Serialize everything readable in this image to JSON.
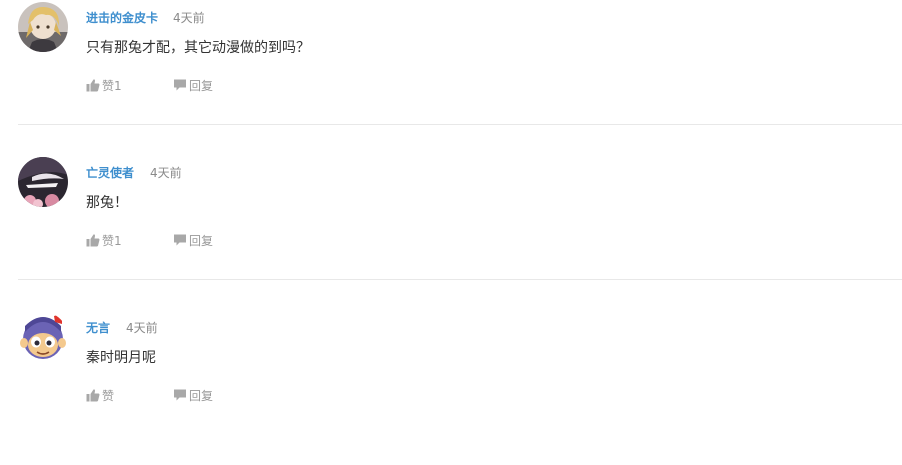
{
  "comments": [
    {
      "username": "进击的金皮卡",
      "time": "4天前",
      "content": "只有那兔才配，其它动漫做的到吗？",
      "like_label": "赞1",
      "reply_label": "回复"
    },
    {
      "username": "亡灵使者",
      "time": "4天前",
      "content": "那兔！",
      "like_label": "赞1",
      "reply_label": "回复"
    },
    {
      "username": "无言",
      "time": "4天前",
      "content": "秦时明月呢",
      "like_label": "赞",
      "reply_label": "回复"
    }
  ],
  "colors": {
    "username": "#3f8fce",
    "meta": "#8a8a8a",
    "action": "#999999",
    "content": "#333333",
    "divider": "#e8e8e8"
  },
  "icons": {
    "like": "thumbs-up-icon",
    "reply": "speech-bubble-icon"
  }
}
